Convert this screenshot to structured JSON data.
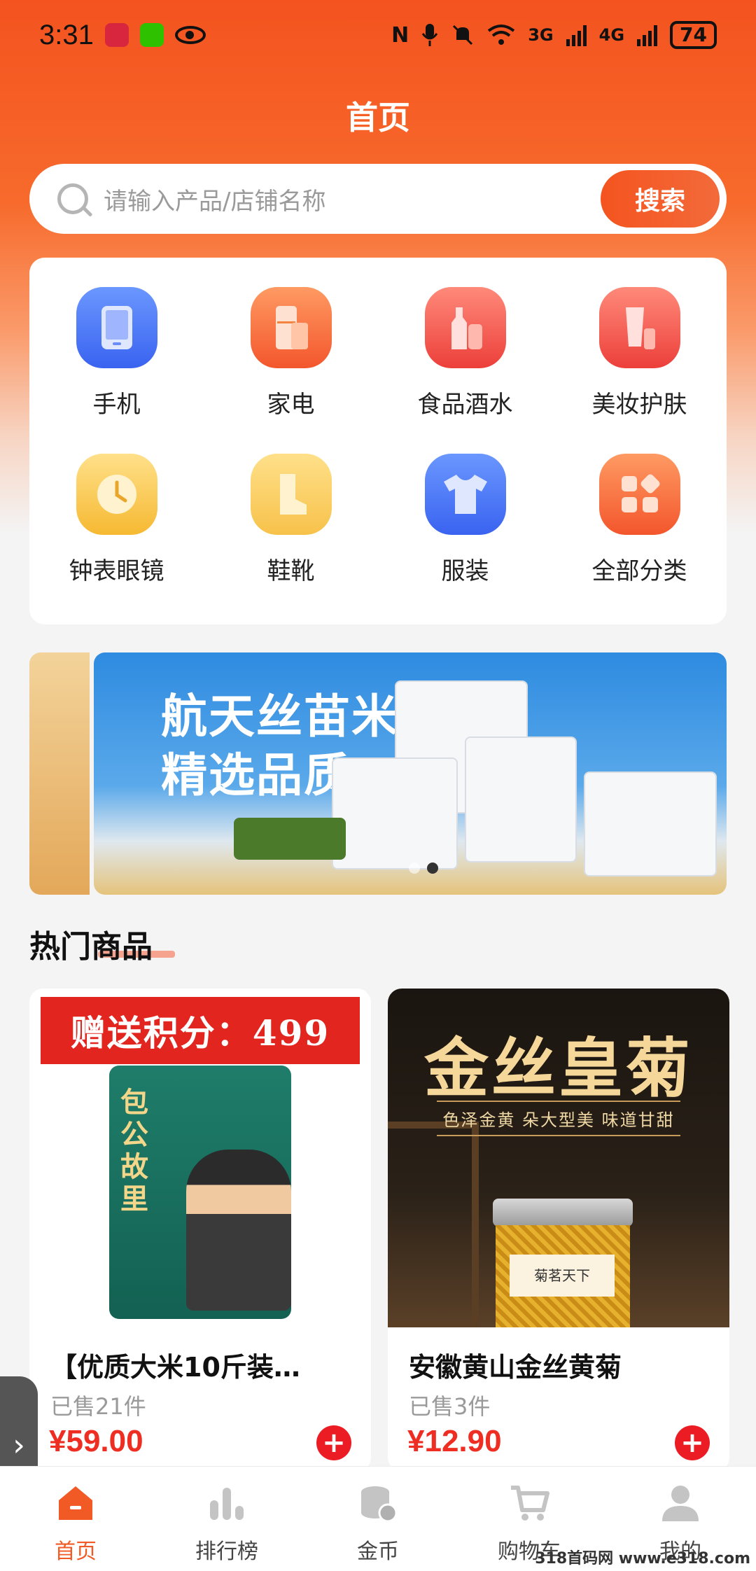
{
  "status_bar": {
    "time": "3:31",
    "signal_3g": "3G",
    "signal_4g": "4G",
    "battery": "74"
  },
  "header": {
    "title": "首页"
  },
  "search": {
    "placeholder": "请输入产品/店铺名称",
    "button_label": "搜索"
  },
  "categories": [
    {
      "label": "手机",
      "icon": "phone-icon",
      "color": "#4a72f5"
    },
    {
      "label": "家电",
      "icon": "fridge-icon",
      "color": "#f4602f"
    },
    {
      "label": "食品酒水",
      "icon": "bottle-icon",
      "color": "#ee4a40"
    },
    {
      "label": "美妆护肤",
      "icon": "cosmetics-icon",
      "color": "#ee4a40"
    },
    {
      "label": "钟表眼镜",
      "icon": "clock-icon",
      "color": "#f6b932"
    },
    {
      "label": "鞋靴",
      "icon": "boot-icon",
      "color": "#f7c24a"
    },
    {
      "label": "服装",
      "icon": "shirt-icon",
      "color": "#4a72f5"
    },
    {
      "label": "全部分类",
      "icon": "grid-icon",
      "color": "#f4602f"
    }
  ],
  "banner": {
    "headline_line1": "航天丝苗米",
    "headline_line2": "精选品质。",
    "pages": 2,
    "active_page": 2
  },
  "hot_section": {
    "title": "热门商品"
  },
  "products": [
    {
      "points_badge": "赠送积分：499",
      "package_text": "包公故里",
      "name": "【优质大米10斤装…",
      "sold": "已售21件",
      "price": "¥59.00"
    },
    {
      "image_title": "金丝皇菊",
      "image_subtitle": "色泽金黄 朵大型美 味道甘甜",
      "jar_label": "菊茗天下",
      "name": "安徽黄山金丝黄菊",
      "sold": "已售3件",
      "price": "¥12.90"
    }
  ],
  "tabbar": {
    "items": [
      {
        "label": "首页",
        "icon": "home-icon",
        "active": true
      },
      {
        "label": "排行榜",
        "icon": "ranking-icon",
        "active": false
      },
      {
        "label": "金币",
        "icon": "coins-icon",
        "active": false
      },
      {
        "label": "购物车",
        "icon": "cart-icon",
        "active": false
      },
      {
        "label": "我的",
        "icon": "profile-icon",
        "active": false
      }
    ]
  },
  "watermark": "318首码网 www.e318.com",
  "colors": {
    "accent": "#f15a24",
    "price": "#ee2d23"
  }
}
